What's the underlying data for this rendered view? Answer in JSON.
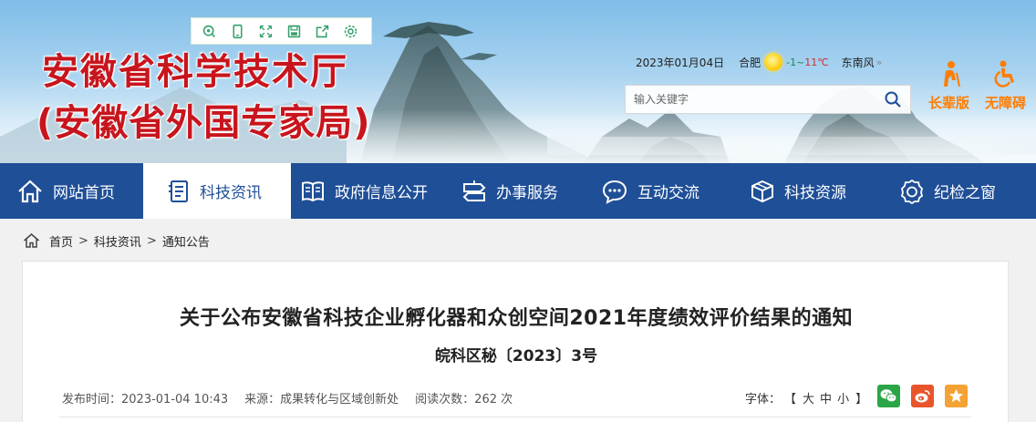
{
  "toolbar": {
    "icons": [
      "qr-code-icon",
      "mobile-icon",
      "fullscreen-icon",
      "save-icon",
      "share-icon",
      "settings-icon"
    ]
  },
  "header": {
    "title": "安徽省科学技术厅",
    "subtitle": "(安徽省外国专家局)"
  },
  "weather": {
    "date": "2023年01月04日",
    "city": "合肥",
    "temp_low": "-1",
    "temp_sep": "~",
    "temp_high": "11℃",
    "wind": "东南风",
    "more": "»"
  },
  "search": {
    "placeholder": "输入关键字"
  },
  "accessibility": {
    "elder_label": "长辈版",
    "barrier_free_label": "无障碍"
  },
  "nav": {
    "items": [
      {
        "label": "网站首页",
        "icon": "home-icon"
      },
      {
        "label": "科技资讯",
        "icon": "document-icon",
        "active": true
      },
      {
        "label": "政府信息公开",
        "icon": "book-icon"
      },
      {
        "label": "办事服务",
        "icon": "signpost-icon"
      },
      {
        "label": "互动交流",
        "icon": "chat-icon"
      },
      {
        "label": "科技资源",
        "icon": "box-icon"
      },
      {
        "label": "纪检之窗",
        "icon": "badge-icon"
      }
    ]
  },
  "breadcrumb": {
    "home": "首页",
    "sep": ">",
    "level1": "科技资讯",
    "level2": "通知公告"
  },
  "article": {
    "title": "关于公布安徽省科技企业孵化器和众创空间2021年度绩效评价结果的通知",
    "doc_number": "皖科区秘〔2023〕3号",
    "publish_time": "发布时间：2023-01-04 10:43",
    "source": "来源：成果转化与区域创新处",
    "views": "阅读次数：262 次",
    "font_size_label": "字体：",
    "font_open": "【",
    "font_large": "大",
    "font_medium": "中",
    "font_small": "小",
    "font_close": "】"
  },
  "colors": {
    "nav_bg": "#1f4f97",
    "title_red": "#c8151d",
    "accent_orange": "#ff7d00",
    "wechat": "#2ba646",
    "weibo": "#e9552b",
    "favorite": "#f4a234"
  }
}
